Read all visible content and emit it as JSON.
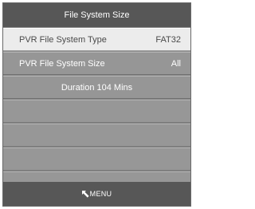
{
  "menu": {
    "title": "File System Size",
    "rows": [
      {
        "label": "PVR File System Type",
        "value": "FAT32"
      },
      {
        "label": "PVR File System Size",
        "value": "All"
      }
    ],
    "duration": "Duration 104 Mins",
    "footer": {
      "icon": "menu-arrow-icon",
      "label": "MENU"
    }
  },
  "colors": {
    "panel": "#8e8e8e",
    "header": "#575757",
    "selected_row": "#ececec",
    "text_light": "#ffffff",
    "text_dark": "#4a4a4a"
  }
}
